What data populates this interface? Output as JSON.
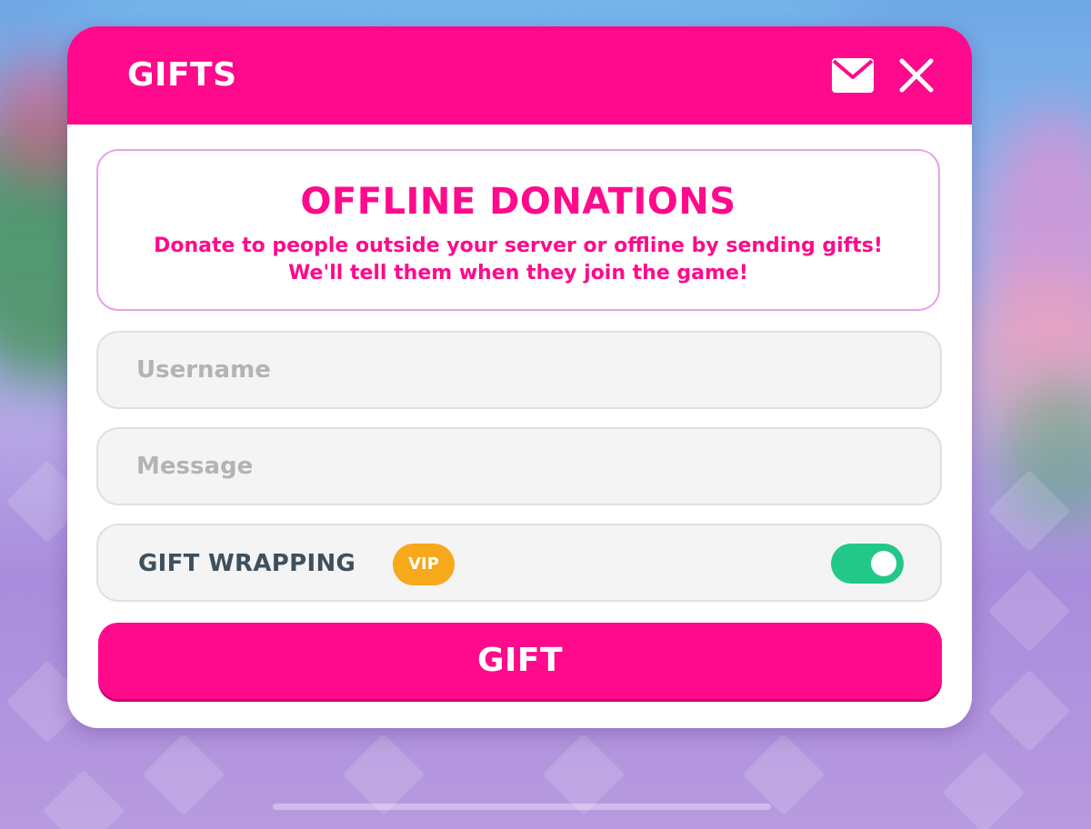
{
  "modal": {
    "title": "GIFTS",
    "header_icons": [
      "mail-icon",
      "close-icon"
    ]
  },
  "info": {
    "title": "OFFLINE DONATIONS",
    "description_line1": "Donate to people outside your server or offline by sending gifts!",
    "description_line2": "We'll tell them when they join the game!"
  },
  "form": {
    "username": {
      "placeholder": "Username",
      "value": ""
    },
    "message": {
      "placeholder": "Message",
      "value": ""
    },
    "gift_wrapping": {
      "label": "GIFT WRAPPING",
      "badge": "VIP",
      "enabled": true
    },
    "submit_label": "GIFT"
  },
  "colors": {
    "primary": "#ff0a8c",
    "card_border": "#e7a3ea",
    "toggle_on": "#22c888",
    "vip_badge": "#f7a81b",
    "label_text": "#3f505c",
    "placeholder": "#b3b3b3"
  }
}
